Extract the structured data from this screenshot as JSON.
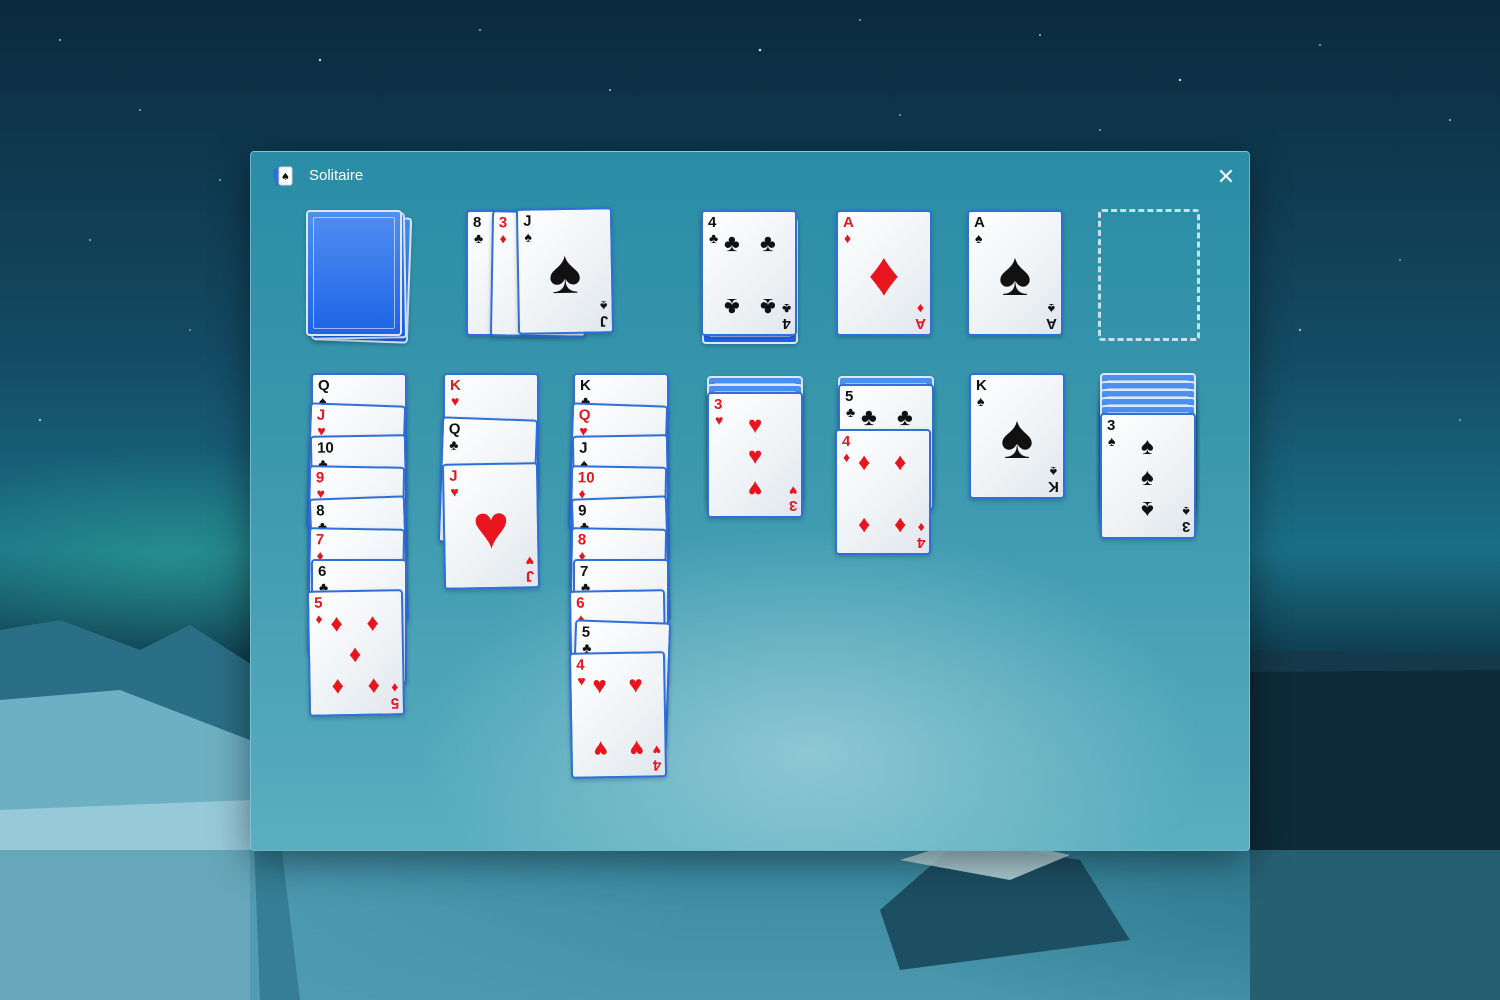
{
  "window": {
    "title": "Solitaire",
    "close_glyph": "✕",
    "app_icon": "solitaire-app-icon"
  },
  "colors": {
    "red_suit": "#e8151f",
    "black_suit": "#111111",
    "card_border": "#2f6fd8",
    "card_back": "#1f63e6"
  },
  "suit_glyphs": {
    "spades": "♠",
    "hearts": "♥",
    "diamonds": "♦",
    "clubs": "♣"
  },
  "stock": {
    "face_down": true
  },
  "waste": [
    {
      "rank": "8",
      "suit": "♣"
    },
    {
      "rank": "3",
      "suit": "♦"
    },
    {
      "rank": "J",
      "suit": "♠"
    }
  ],
  "foundations": [
    {
      "rank": "4",
      "suit": "♣"
    },
    {
      "rank": "A",
      "suit": "♦"
    },
    {
      "rank": "A",
      "suit": "♠"
    },
    {
      "empty": true
    }
  ],
  "tableau": [
    {
      "face_down": 0,
      "cards": [
        {
          "rank": "Q",
          "suit": "♠"
        },
        {
          "rank": "J",
          "suit": "♥"
        },
        {
          "rank": "10",
          "suit": "♣"
        },
        {
          "rank": "9",
          "suit": "♥"
        },
        {
          "rank": "8",
          "suit": "♣"
        },
        {
          "rank": "7",
          "suit": "♦"
        },
        {
          "rank": "6",
          "suit": "♣"
        },
        {
          "rank": "5",
          "suit": "♦"
        }
      ]
    },
    {
      "face_down": 0,
      "cards": [
        {
          "rank": "K",
          "suit": "♥"
        },
        {
          "rank": "Q",
          "suit": "♣"
        },
        {
          "rank": "J",
          "suit": "♥"
        }
      ]
    },
    {
      "face_down": 0,
      "cards": [
        {
          "rank": "K",
          "suit": "♣"
        },
        {
          "rank": "Q",
          "suit": "♥"
        },
        {
          "rank": "J",
          "suit": "♠"
        },
        {
          "rank": "10",
          "suit": "♦"
        },
        {
          "rank": "9",
          "suit": "♣"
        },
        {
          "rank": "8",
          "suit": "♦"
        },
        {
          "rank": "7",
          "suit": "♣"
        },
        {
          "rank": "6",
          "suit": "♦"
        },
        {
          "rank": "5",
          "suit": "♣"
        },
        {
          "rank": "4",
          "suit": "♥"
        }
      ]
    },
    {
      "face_down": 2,
      "cards": [
        {
          "rank": "3",
          "suit": "♥"
        }
      ]
    },
    {
      "face_down": 1,
      "cards": [
        {
          "rank": "5",
          "suit": "♣"
        },
        {
          "rank": "4",
          "suit": "♦"
        }
      ]
    },
    {
      "face_down": 0,
      "cards": [
        {
          "rank": "K",
          "suit": "♠"
        }
      ]
    },
    {
      "face_down": 5,
      "cards": [
        {
          "rank": "3",
          "suit": "♠"
        }
      ]
    }
  ]
}
